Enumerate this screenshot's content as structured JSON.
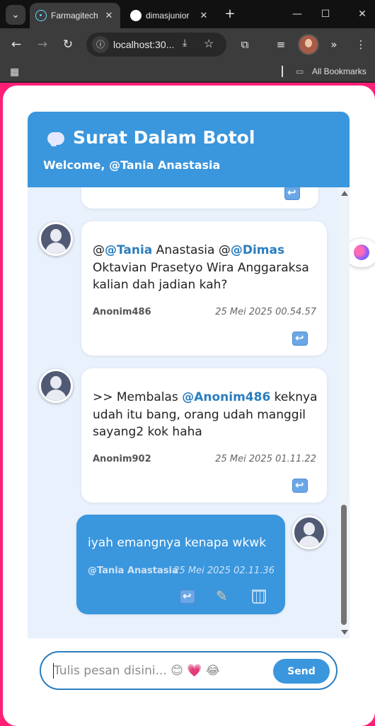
{
  "browser": {
    "tabs": [
      {
        "title": "Farmagitech",
        "icon": "react-icon",
        "active": true
      },
      {
        "title": "dimasjunior",
        "icon": "github-icon",
        "active": false
      }
    ],
    "address": "localhost:30...",
    "bookmarks_label": "All Bookmarks"
  },
  "app": {
    "title": "Surat Dalam Botol",
    "welcome": "Welcome, @Tania Anastasia"
  },
  "messages": [
    {
      "parts": [
        {
          "text": "@",
          "mention": false
        },
        {
          "text": "@Tania",
          "mention": true
        },
        {
          "text": " Anastasia @",
          "mention": false
        },
        {
          "text": "@Dimas",
          "mention": true
        },
        {
          "text": " Oktavian Prasetyo Wira Anggaraksa kalian dah jadian kah?",
          "mention": false
        }
      ],
      "sender": "Anonim486",
      "time": "25 Mei 2025 00.54.57",
      "mine": false
    },
    {
      "parts": [
        {
          "text": ">> Membalas ",
          "mention": false
        },
        {
          "text": "@Anonim486",
          "mention": true
        },
        {
          "text": " keknya udah itu bang, orang udah manggil sayang2 kok haha",
          "mention": false
        }
      ],
      "sender": "Anonim902",
      "time": "25 Mei 2025 01.11.22",
      "mine": false
    },
    {
      "parts": [
        {
          "text": "iyah emangnya kenapa wkwk",
          "mention": false
        }
      ],
      "sender": "@Tania Anastasia",
      "time": "25 Mei 2025 02.11.36",
      "mine": true
    }
  ],
  "composer": {
    "placeholder": "Tulis pesan disini... 😊 💗 😂",
    "send_label": "Send"
  },
  "colors": {
    "accent": "#3a96dd",
    "chat_bg": "#e8f1fc",
    "page_border": "#ff1f76"
  }
}
